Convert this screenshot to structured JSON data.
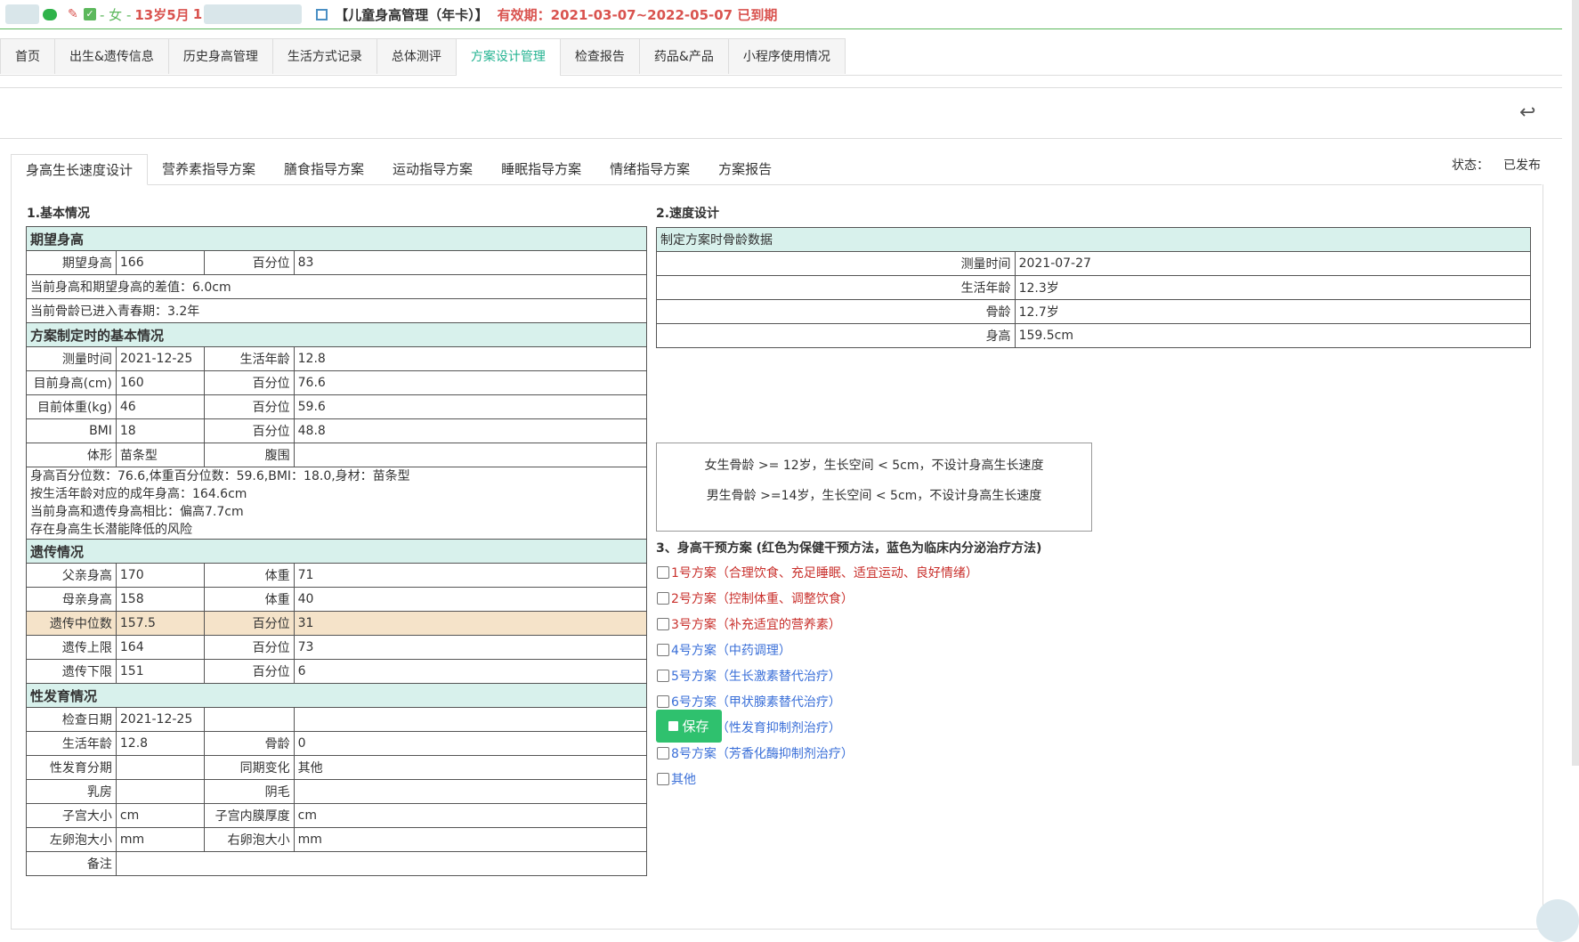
{
  "patient": {
    "gender": "- 女 -",
    "age": "13岁5月",
    "id_prefix": "1",
    "card": "【儿童身高管理（年卡）】",
    "validity": "有效期：2021-03-07~2022-05-07 已到期"
  },
  "main_tabs": [
    "首页",
    "出生&遗传信息",
    "历史身高管理",
    "生活方式记录",
    "总体测评",
    "方案设计管理",
    "检查报告",
    "药品&产品",
    "小程序使用情况"
  ],
  "sub_tabs": [
    "身高生长速度设计",
    "营养素指导方案",
    "膳食指导方案",
    "运动指导方案",
    "睡眠指导方案",
    "情绪指导方案",
    "方案报告"
  ],
  "status": {
    "label": "状态：",
    "value": "已发布"
  },
  "basic": {
    "section_title": "1.基本情况",
    "expected": {
      "header": "期望身高",
      "height_label": "期望身高",
      "height_value": "166",
      "pct_label": "百分位",
      "pct_value": "83",
      "diff": "当前身高和期望身高的差值：6.0cm",
      "puberty": "当前骨龄已进入青春期：3.2年"
    },
    "plan_basic": {
      "header": "方案制定时的基本情况",
      "rows": [
        {
          "l1": "测量时间",
          "v1": "2021-12-25",
          "l2": "生活年龄",
          "v2": "12.8"
        },
        {
          "l1": "目前身高(cm)",
          "v1": "160",
          "l2": "百分位",
          "v2": "76.6"
        },
        {
          "l1": "目前体重(kg)",
          "v1": "46",
          "l2": "百分位",
          "v2": "59.6"
        },
        {
          "l1": "BMI",
          "v1": "18",
          "l2": "百分位",
          "v2": "48.8"
        },
        {
          "l1": "体形",
          "v1": "苗条型",
          "l2": "腹围",
          "v2": ""
        }
      ],
      "note1": "身高百分位数：76.6,体重百分位数：59.6,BMI：18.0,身材：苗条型",
      "note2": "按生活年龄对应的成年身高：164.6cm",
      "note3": "当前身高和遗传身高相比：偏高7.7cm",
      "note4": "存在身高生长潜能降低的风险"
    },
    "heredity": {
      "header": "遗传情况",
      "rows": [
        {
          "l1": "父亲身高",
          "v1": "170",
          "l2": "体重",
          "v2": "71"
        },
        {
          "l1": "母亲身高",
          "v1": "158",
          "l2": "体重",
          "v2": "40"
        },
        {
          "l1": "遗传中位数",
          "v1": "157.5",
          "l2": "百分位",
          "v2": "31"
        },
        {
          "l1": "遗传上限",
          "v1": "164",
          "l2": "百分位",
          "v2": "73"
        },
        {
          "l1": "遗传下限",
          "v1": "151",
          "l2": "百分位",
          "v2": "6"
        }
      ]
    },
    "sexual": {
      "header": "性发育情况",
      "rows": [
        {
          "l1": "检查日期",
          "v1": "2021-12-25",
          "l2": "",
          "v2": ""
        },
        {
          "l1": "生活年龄",
          "v1": "12.8",
          "l2": "骨龄",
          "v2": "0"
        },
        {
          "l1": "性发育分期",
          "v1": "",
          "l2": "同期变化",
          "v2": "其他"
        },
        {
          "l1": "乳房",
          "v1": "",
          "l2": "阴毛",
          "v2": ""
        },
        {
          "l1": "子宫大小",
          "v1": "cm",
          "l2": "子宫内膜厚度",
          "v2": "cm"
        },
        {
          "l1": "左卵泡大小",
          "v1": "mm",
          "l2": "右卵泡大小",
          "v2": "mm"
        }
      ],
      "remark_label": "备注"
    }
  },
  "speed": {
    "section_title": "2.速度设计",
    "table_header": "制定方案时骨龄数据",
    "rows": [
      {
        "label": "测量时间",
        "value": "2021-07-27"
      },
      {
        "label": "生活年龄",
        "value": "12.3岁"
      },
      {
        "label": "骨龄",
        "value": "12.7岁"
      },
      {
        "label": "身高",
        "value": "159.5cm"
      }
    ],
    "rule1": "女生骨龄 >= 12岁，生长空间 < 5cm，不设计身高生长速度",
    "rule2": "男生骨龄 >=14岁，生长空间 < 5cm，不设计身高生长速度"
  },
  "intervention": {
    "title": "3、身高干预方案 (红色为保健干预方法，蓝色为临床内分泌治疗方法)",
    "options": [
      {
        "label": "1号方案（合理饮食、充足睡眠、适宜运动、良好情绪）",
        "color": "red"
      },
      {
        "label": "2号方案（控制体重、调整饮食）",
        "color": "red"
      },
      {
        "label": "3号方案（补充适宜的营养素）",
        "color": "red"
      },
      {
        "label": "4号方案（中药调理）",
        "color": "blue"
      },
      {
        "label": "5号方案（生长激素替代治疗）",
        "color": "blue"
      },
      {
        "label": "6号方案（甲状腺素替代治疗）",
        "color": "blue"
      },
      {
        "label": "7号方案（性发育抑制剂治疗）",
        "color": "blue"
      },
      {
        "label": "8号方案（芳香化酶抑制剂治疗）",
        "color": "blue"
      },
      {
        "label": "其他",
        "color": "blue"
      }
    ],
    "save_label": "保存"
  },
  "colors": {
    "accent": "#23b391",
    "save": "#2fc16e",
    "expired": "#d9534f",
    "header_bg": "#d8f1ec",
    "highlight": "#f5e3c9"
  }
}
